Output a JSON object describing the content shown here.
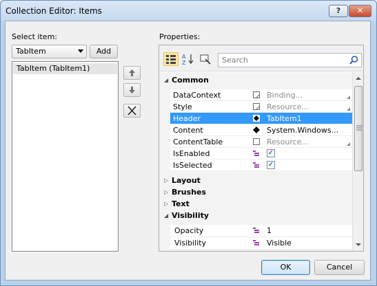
{
  "window": {
    "title": "Collection Editor: Items",
    "help": "?",
    "close": "✕"
  },
  "left": {
    "select_label": "Select item:",
    "combo_value": "TabItem",
    "add_label": "Add",
    "items": [
      "TabItem (TabItem1)"
    ]
  },
  "properties": {
    "label": "Properties:",
    "search_placeholder": "Search",
    "categories": {
      "common": "Common",
      "layout": "Layout",
      "brushes": "Brushes",
      "text": "Text",
      "visibility": "Visibility"
    },
    "common": [
      {
        "name": "DataContext",
        "value": "Binding..."
      },
      {
        "name": "Style",
        "value": "Resource..."
      },
      {
        "name": "Header",
        "value": "TabItem1"
      },
      {
        "name": "Content",
        "value": "System.Windows..."
      },
      {
        "name": "ContentTable",
        "value": "Resource..."
      },
      {
        "name": "IsEnabled",
        "value": "✓"
      },
      {
        "name": "IsSelected",
        "value": "✓"
      }
    ],
    "visibility": [
      {
        "name": "Opacity",
        "value": "1"
      },
      {
        "name": "Visibility",
        "value": "Visible"
      }
    ]
  },
  "buttons": {
    "ok": "OK",
    "cancel": "Cancel"
  }
}
